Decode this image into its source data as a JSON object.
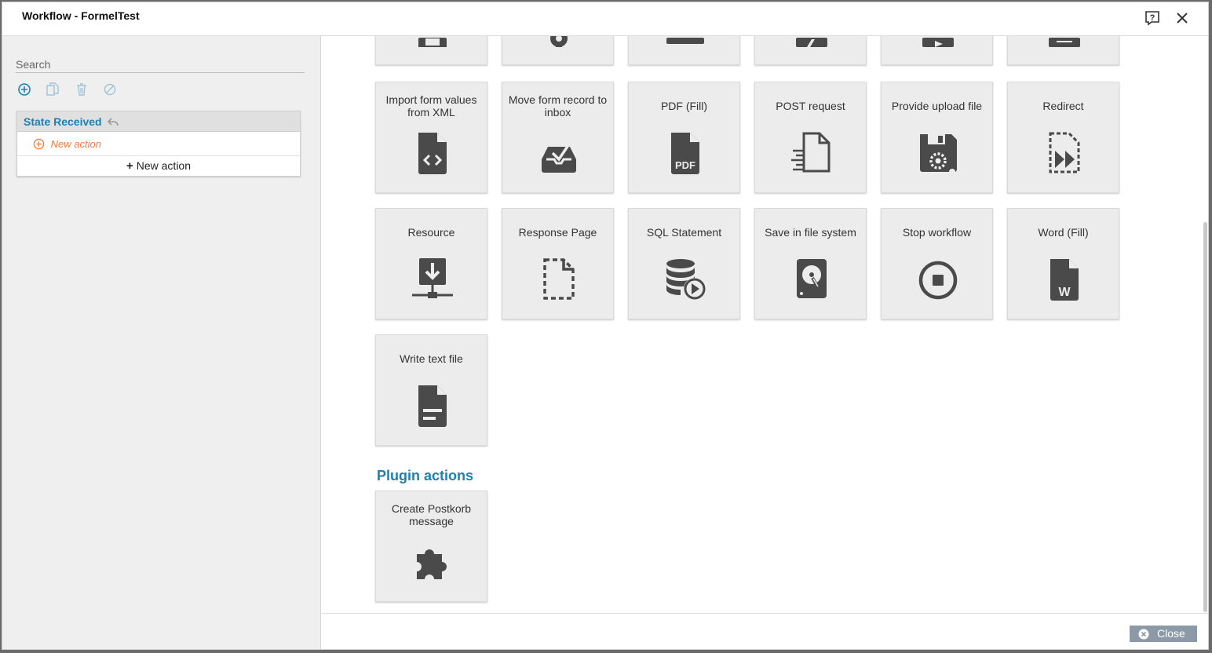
{
  "window": {
    "title": "Workflow - FormelTest"
  },
  "titlebar": {
    "help_icon": "help-icon",
    "close_icon": "close-icon"
  },
  "sidebar": {
    "search": {
      "placeholder": "Search",
      "value": ""
    },
    "toolbar": [
      "add-circle-icon",
      "copy-icon",
      "trash-icon",
      "disable-icon"
    ],
    "state": {
      "title": "State Received",
      "new_action_item": "New action",
      "new_action_button": "New action"
    }
  },
  "main": {
    "partial_row_icons": [
      "id-card-icon",
      "gear-icon",
      "keyboard-icon",
      "lightning-icon",
      "share-icon",
      "download-icon"
    ],
    "actions": [
      {
        "label": "Import form values from XML",
        "icon": "file-code-icon"
      },
      {
        "label": "Move form record to inbox",
        "icon": "inbox-icon"
      },
      {
        "label": "PDF (Fill)",
        "icon": "pdf-file-icon"
      },
      {
        "label": "POST request",
        "icon": "post-request-icon"
      },
      {
        "label": "Provide upload file",
        "icon": "floppy-gear-icon"
      },
      {
        "label": "Redirect",
        "icon": "redirect-icon"
      },
      {
        "label": "Resource",
        "icon": "resource-download-icon"
      },
      {
        "label": "Response Page",
        "icon": "dashed-file-icon"
      },
      {
        "label": "SQL Statement",
        "icon": "database-play-icon"
      },
      {
        "label": "Save in file system",
        "icon": "hard-disk-icon"
      },
      {
        "label": "Stop workflow",
        "icon": "stop-circle-icon"
      },
      {
        "label": "Word (Fill)",
        "icon": "word-file-icon"
      },
      {
        "label": "Write text file",
        "icon": "text-file-icon"
      }
    ],
    "plugin_title": "Plugin actions",
    "plugin_actions": [
      {
        "label": "Create Postkorb message",
        "icon": "puzzle-icon"
      }
    ]
  },
  "footer": {
    "close_label": "Close"
  },
  "colors": {
    "accent": "#1a82b3",
    "new_action": "#f27a3b",
    "icon": "#4a4a4a",
    "tile_bg": "#ececec",
    "close_button": "#8c9aa8"
  }
}
